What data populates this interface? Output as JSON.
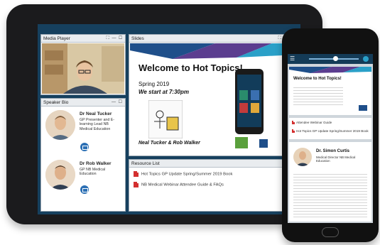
{
  "tablet": {
    "media_player": {
      "title": "Media Player"
    },
    "speaker_bio": {
      "title": "Speaker Bio",
      "speakers": [
        {
          "name": "Dr Neal Tucker",
          "role": "GP Presenter and E-learning Lead NB Medical Education"
        },
        {
          "name": "Dr Rob Walker",
          "role": "GP NB Medical Education"
        }
      ]
    },
    "slides": {
      "title": "Slides",
      "headline": "Welcome to Hot Topics!",
      "season": "Spring 2019",
      "start": "We start at 7:30pm",
      "authors": "Neal Tucker & Rob Walker"
    },
    "resources": {
      "title": "Resource List",
      "items": [
        "Hot Topics GP Update Spring/Summer 2019 Book",
        "NB Medical Webinar Attendee Guide & FAQs"
      ]
    }
  },
  "phone": {
    "slide_headline": "Welcome to Hot Topics!",
    "resources": [
      "Attendee Webinar Guide",
      "Hot Topics GP Update Spring/Summer 2019 Book"
    ],
    "speaker": {
      "name": "Dr. Simon Curtis",
      "role": "Medical Director NB Medical Education"
    }
  },
  "colors": {
    "frame": "#16405e",
    "accent": "#2b6fb4",
    "pdf": "#d32f2f"
  }
}
